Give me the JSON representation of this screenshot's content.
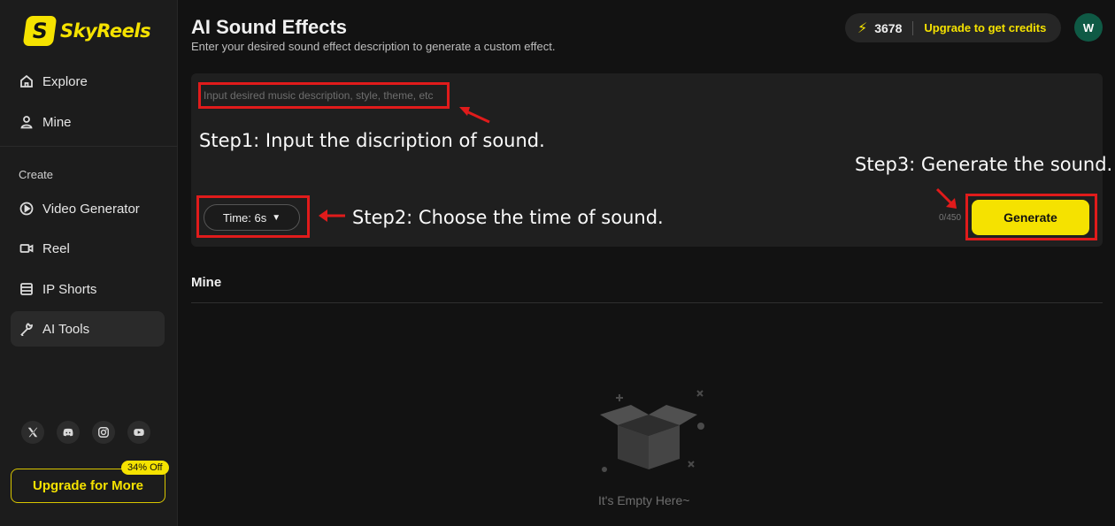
{
  "brand": {
    "name": "SkyReels"
  },
  "sidebar": {
    "items": [
      {
        "label": "Explore",
        "icon": "home-icon"
      },
      {
        "label": "Mine",
        "icon": "user-icon"
      }
    ],
    "create_label": "Create",
    "create_items": [
      {
        "label": "Video Generator",
        "icon": "play-circle-icon"
      },
      {
        "label": "Reel",
        "icon": "video-camera-icon"
      },
      {
        "label": "IP Shorts",
        "icon": "film-icon"
      },
      {
        "label": "AI Tools",
        "icon": "wrench-icon",
        "active": true
      }
    ],
    "social": [
      "x-icon",
      "discord-icon",
      "instagram-icon",
      "youtube-icon"
    ],
    "upgrade_label": "Upgrade for More",
    "upgrade_badge": "34% Off"
  },
  "header": {
    "title": "AI Sound Effects",
    "subtitle": "Enter your desired sound effect description to generate a custom effect.",
    "credits": "3678",
    "upgrade_link": "Upgrade to get credits",
    "avatar_initial": "W"
  },
  "prompt": {
    "placeholder": "Input desired music description, style, theme, etc",
    "value": "",
    "time_label": "Time: 6s",
    "counter": "0/450",
    "generate_label": "Generate"
  },
  "annotations": {
    "step1": "Step1: Input the discription of sound.",
    "step2": "Step2: Choose the time of sound.",
    "step3": "Step3: Generate the sound."
  },
  "mine": {
    "title": "Mine",
    "empty_text": "It's Empty Here~"
  },
  "colors": {
    "accent": "#f5e200",
    "background": "#121212",
    "annotation": "#e01b1b"
  }
}
